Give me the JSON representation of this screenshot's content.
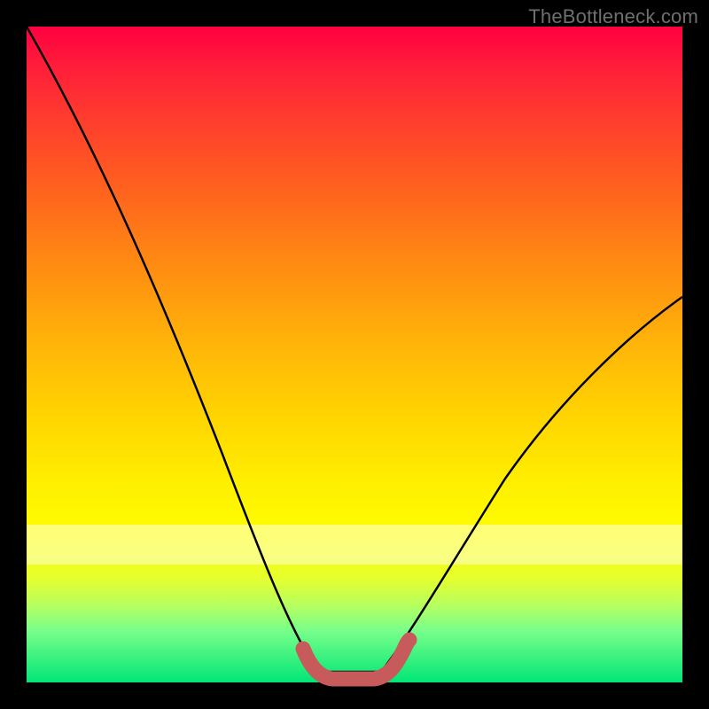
{
  "watermark": "TheBottleneck.com",
  "colors": {
    "page_bg": "#000000",
    "curve": "#000000",
    "bulge": "#c75a5a",
    "watermark": "#6f6f6f"
  },
  "chart_data": {
    "type": "line",
    "title": "",
    "xlabel": "",
    "ylabel": "",
    "xlim": [
      0,
      100
    ],
    "ylim": [
      0,
      100
    ],
    "grid": false,
    "series": [
      {
        "name": "bottleneck-curve",
        "x": [
          0,
          6,
          12,
          18,
          24,
          30,
          34,
          38,
          41,
          43,
          44.5,
          46,
          50,
          54,
          55.5,
          57,
          60,
          65,
          72,
          80,
          88,
          95,
          100
        ],
        "y": [
          100,
          85,
          70,
          56,
          43,
          31,
          23,
          15,
          8,
          4,
          1.5,
          0.5,
          0.3,
          0.5,
          1.5,
          4,
          9,
          16,
          26,
          37,
          47,
          54,
          59
        ]
      }
    ],
    "annotations": [
      {
        "type": "bulge",
        "xrange": [
          42,
          58
        ],
        "yrange": [
          0,
          6
        ],
        "color": "#c75a5a"
      }
    ],
    "background_gradient": {
      "top": "#ff0040",
      "mid": "#ffe500",
      "bottom": "#00e676"
    }
  }
}
